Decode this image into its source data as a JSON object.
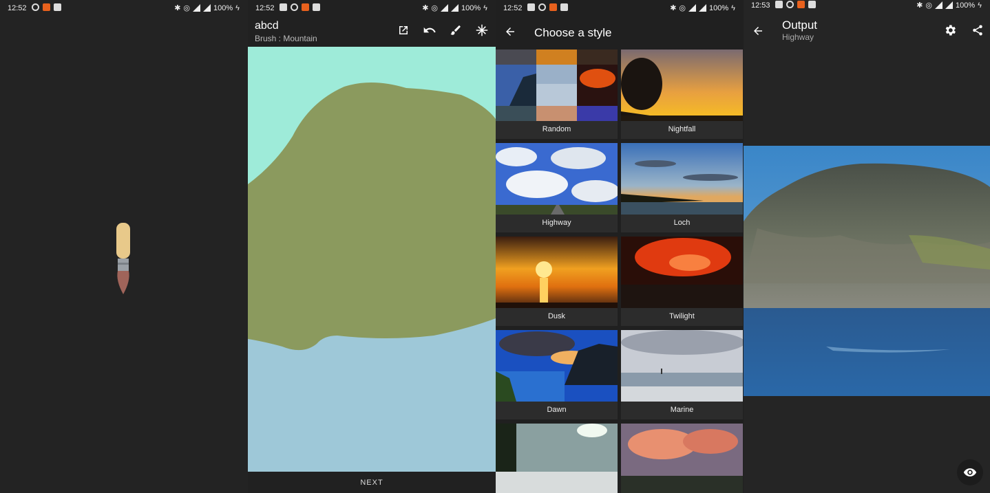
{
  "status_bars": [
    {
      "time": "12:52",
      "battery": "100%"
    },
    {
      "time": "12:52",
      "battery": "100%"
    },
    {
      "time": "12:52",
      "battery": "100%"
    },
    {
      "time": "12:53",
      "battery": "100%"
    }
  ],
  "splash": {
    "icon": "paintbrush-icon"
  },
  "editor": {
    "title": "abcd",
    "subtitle": "Brush : Mountain",
    "toolbar_icons": [
      "open-in-new-icon",
      "undo-icon",
      "brush-icon",
      "snowflake-icon"
    ],
    "next_label": "NEXT",
    "colors": {
      "sky": "#9eebd9",
      "mountain": "#8b9a5e",
      "water": "#9ec8d8"
    }
  },
  "style_picker": {
    "title": "Choose a style",
    "back_icon": "arrow-back-icon",
    "styles": [
      {
        "label": "Random"
      },
      {
        "label": "Nightfall"
      },
      {
        "label": "Highway"
      },
      {
        "label": "Loch"
      },
      {
        "label": "Dusk"
      },
      {
        "label": "Twilight"
      },
      {
        "label": "Dawn"
      },
      {
        "label": "Marine"
      },
      {
        "label": ""
      },
      {
        "label": ""
      }
    ]
  },
  "output": {
    "title": "Output",
    "subtitle": "Highway",
    "action_icons": [
      "settings-icon",
      "share-icon"
    ],
    "fab_icon": "eye-icon"
  }
}
